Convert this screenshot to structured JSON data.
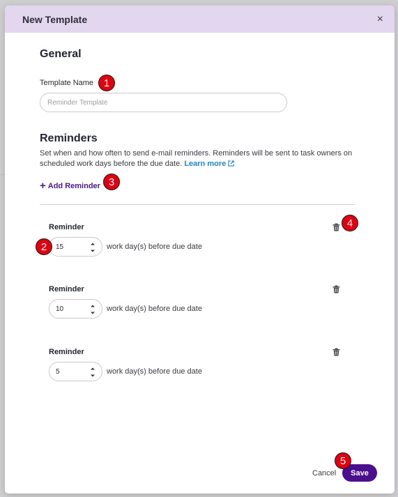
{
  "modal": {
    "title": "New Template",
    "close_label": "×"
  },
  "general": {
    "heading": "General",
    "template_name_label": "Template Name",
    "template_name_placeholder": "Reminder Template",
    "template_name_value": ""
  },
  "reminders": {
    "heading": "Reminders",
    "description": "Set when and how often to send e-mail reminders. Reminders will be sent to task owners on scheduled work days before the due date.",
    "learn_more": "Learn more",
    "add_label": "Add Reminder",
    "add_icon": "plus-icon",
    "items": [
      {
        "title": "Reminder",
        "value": "15",
        "suffix": "work day(s) before due date",
        "delete_icon": "trash-icon"
      },
      {
        "title": "Reminder",
        "value": "10",
        "suffix": "work day(s) before due date",
        "delete_icon": "trash-icon"
      },
      {
        "title": "Reminder",
        "value": "5",
        "suffix": "work day(s) before due date",
        "delete_icon": "trash-icon"
      }
    ]
  },
  "footer": {
    "cancel_label": "Cancel",
    "save_label": "Save"
  },
  "annotations": [
    "1",
    "2",
    "3",
    "4",
    "5"
  ],
  "colors": {
    "header_bg": "#e3d7f0",
    "primary": "#4a0e8f",
    "link": "#1d88c8",
    "badge": "#e00010"
  }
}
